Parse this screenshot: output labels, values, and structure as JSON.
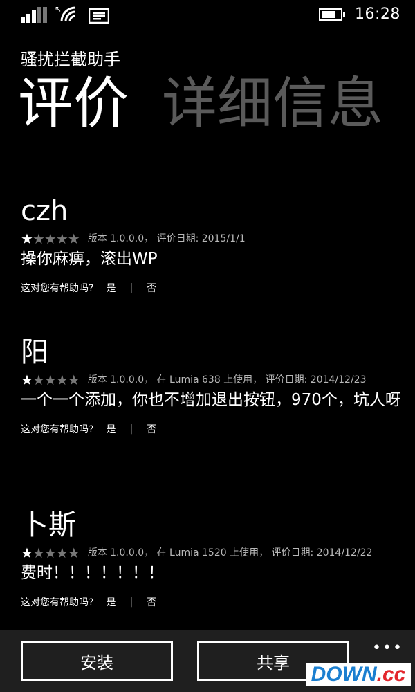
{
  "status_bar": {
    "signal_icon": "cellular-signal-icon",
    "wifi_icon": "wifi-icon",
    "message_icon": "message-icon",
    "battery_icon": "battery-icon",
    "battery_level": 0.75,
    "time": "16:28"
  },
  "app": {
    "title": "骚扰拦截助手"
  },
  "pivot": {
    "tabs": [
      {
        "label": "评价",
        "active": true
      },
      {
        "label": "详细信息",
        "active": false
      }
    ]
  },
  "reviews": [
    {
      "author": "czh",
      "rating": 1,
      "max_rating": 5,
      "meta": "版本 1.0.0.0， 评价日期: 2015/1/1",
      "body": "操你麻痹，滚出WP",
      "helpful_q": "这对您有帮助吗?",
      "yes": "是",
      "no": "否"
    },
    {
      "author": "阳",
      "rating": 1,
      "max_rating": 5,
      "meta": "版本 1.0.0.0， 在 Lumia 638 上使用， 评价日期: 2014/12/23",
      "body": "一个一个添加，你也不增加退出按钮，970个，坑人呀",
      "helpful_q": "这对您有帮助吗?",
      "yes": "是",
      "no": "否"
    },
    {
      "author": "卜斯",
      "rating": 1,
      "max_rating": 5,
      "meta": "版本 1.0.0.0， 在 Lumia 1520 上使用， 评价日期: 2014/12/22",
      "body": "费时！！！！！！！",
      "helpful_q": "这对您有帮助吗?",
      "yes": "是",
      "no": "否"
    }
  ],
  "app_bar": {
    "install_label": "安装",
    "share_label": "共享",
    "more_label": "•••"
  },
  "watermark": {
    "main": "DOWN",
    "suffix": ".cc"
  }
}
